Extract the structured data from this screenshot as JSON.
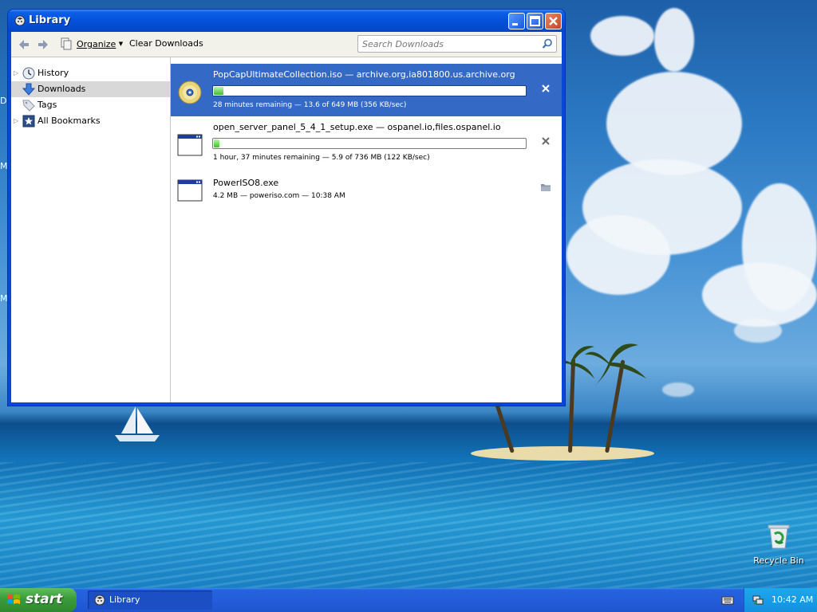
{
  "window": {
    "title": "Library",
    "icon": "firefox-library-icon"
  },
  "toolbar": {
    "back_icon": "back-arrow-icon",
    "forward_icon": "forward-arrow-icon",
    "organize_label": "Organize",
    "clear_label": "Clear Downloads",
    "search_placeholder": "Search Downloads"
  },
  "sidebar": {
    "items": [
      {
        "label": "History",
        "icon": "clock-icon",
        "expandable": true,
        "selected": false
      },
      {
        "label": "Downloads",
        "icon": "download-arrow-icon",
        "expandable": false,
        "selected": true
      },
      {
        "label": "Tags",
        "icon": "tag-icon",
        "expandable": false,
        "selected": false
      },
      {
        "label": "All Bookmarks",
        "icon": "bookmark-star-icon",
        "expandable": true,
        "selected": false
      }
    ]
  },
  "downloads": [
    {
      "name": "PopCapUltimateCollection.iso — archive.org,ia801800.us.archive.org",
      "status": "28 minutes remaining — 13.6 of 649 MB (356 KB/sec)",
      "progress": 0.021,
      "icon": "disc-icon",
      "action_icon": "cancel-x-icon",
      "selected": true
    },
    {
      "name": "open_server_panel_5_4_1_setup.exe — ospanel.io,files.ospanel.io",
      "status": "1 hour, 37 minutes remaining — 5.9 of 736 MB (122 KB/sec)",
      "progress": 0.008,
      "icon": "exe-window-icon",
      "action_icon": "cancel-x-icon",
      "selected": false
    },
    {
      "name": "PowerISO8.exe",
      "status": "4.2 MB — poweriso.com — 10:38 AM",
      "icon": "exe-window-icon",
      "action_icon": "folder-icon",
      "selected": false
    }
  ],
  "desktop": {
    "recycle_bin_label": "Recycle Bin",
    "edge_letters": [
      "D",
      "M",
      "M"
    ]
  },
  "taskbar": {
    "start_label": "start",
    "tasks": [
      {
        "label": "Library"
      }
    ],
    "clock": "10:42 AM"
  },
  "colors": {
    "selection": "#3569c6",
    "titlebar": "#0550d9",
    "progress_fill": "#3fbd2c",
    "start_green": "#3a9b3a"
  }
}
